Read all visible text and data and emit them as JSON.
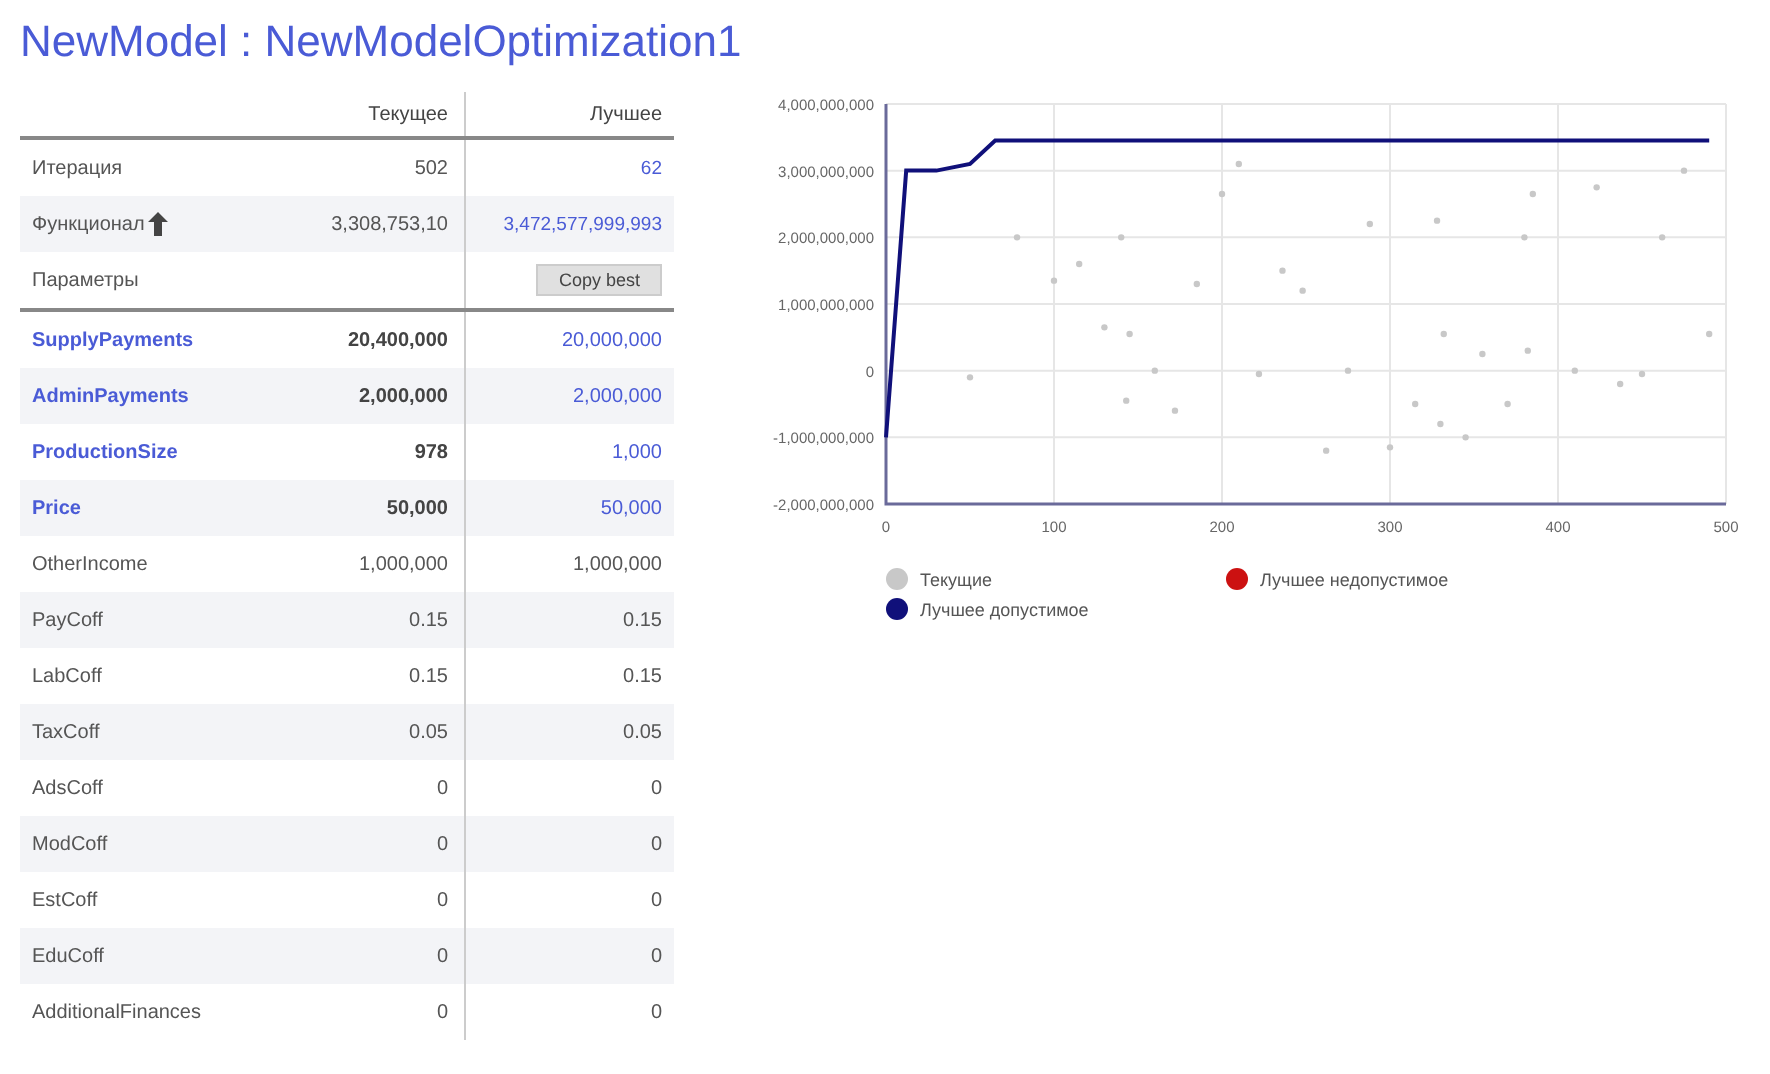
{
  "title": "NewModel : NewModelOptimization1",
  "columns": [
    "Текущее",
    "Лучшее"
  ],
  "summary": [
    {
      "label": "Итерация",
      "current": "502",
      "best": "62",
      "icon": false
    },
    {
      "label": "Функционал",
      "current": "3,308,753,10",
      "best": "3,472,577,999,993",
      "icon": true
    }
  ],
  "params_label": "Параметры",
  "copy_button": "Copy best",
  "params": [
    {
      "name": "SupplyPayments",
      "current": "20,400,000",
      "best": "20,000,000",
      "highlighted": true
    },
    {
      "name": "AdminPayments",
      "current": "2,000,000",
      "best": "2,000,000",
      "highlighted": true
    },
    {
      "name": "ProductionSize",
      "current": "978",
      "best": "1,000",
      "highlighted": true
    },
    {
      "name": "Price",
      "current": "50,000",
      "best": "50,000",
      "highlighted": true
    },
    {
      "name": "OtherIncome",
      "current": "1,000,000",
      "best": "1,000,000",
      "highlighted": false
    },
    {
      "name": "PayCoff",
      "current": "0.15",
      "best": "0.15",
      "highlighted": false
    },
    {
      "name": "LabCoff",
      "current": "0.15",
      "best": "0.15",
      "highlighted": false
    },
    {
      "name": "TaxCoff",
      "current": "0.05",
      "best": "0.05",
      "highlighted": false
    },
    {
      "name": "AdsCoff",
      "current": "0",
      "best": "0",
      "highlighted": false
    },
    {
      "name": "ModCoff",
      "current": "0",
      "best": "0",
      "highlighted": false
    },
    {
      "name": "EstCoff",
      "current": "0",
      "best": "0",
      "highlighted": false
    },
    {
      "name": "EduCoff",
      "current": "0",
      "best": "0",
      "highlighted": false
    },
    {
      "name": "AdditionalFinances",
      "current": "0",
      "best": "0",
      "highlighted": false
    }
  ],
  "chart": {
    "chart_data": {
      "type": "line",
      "x": [
        0,
        12,
        30,
        50,
        65,
        78,
        100,
        115,
        130,
        140,
        143,
        145,
        160,
        172,
        185,
        200,
        210,
        222,
        236,
        248,
        262,
        275,
        288,
        300,
        315,
        328,
        330,
        332,
        345,
        355,
        370,
        380,
        382,
        385,
        400,
        410,
        423,
        437,
        450,
        462,
        475,
        490
      ],
      "series": [
        {
          "name": "Текущие",
          "color": "#c8c8c8",
          "type": "scatter",
          "values": [
            null,
            null,
            null,
            -100000000,
            null,
            2000000000,
            1350000000,
            1600000000,
            650000000,
            2000000000,
            -450000000,
            550000000,
            0,
            -600000000,
            1300000000,
            2650000000,
            3100000000,
            -50000000,
            1500000000,
            1200000000,
            -1200000000,
            0,
            2200000000,
            -1150000000,
            -500000000,
            2250000000,
            -800000000,
            550000000,
            -1000000000,
            250000000,
            -500000000,
            2000000000,
            300000000,
            2650000000,
            null,
            0,
            2750000000,
            -200000000,
            -50000000,
            2000000000,
            3000000000,
            550000000
          ]
        },
        {
          "name": "Лучшее допустимое",
          "color": "#10107a",
          "type": "line",
          "values": [
            -1000000000,
            3000000000,
            3000000000,
            3100000000,
            3450000000,
            3450000000,
            3450000000,
            3450000000,
            3450000000,
            3450000000,
            3450000000,
            3450000000,
            3450000000,
            3450000000,
            3450000000,
            3450000000,
            3450000000,
            3450000000,
            3450000000,
            3450000000,
            3450000000,
            3450000000,
            3450000000,
            3450000000,
            3450000000,
            3450000000,
            3450000000,
            3450000000,
            3450000000,
            3450000000,
            3450000000,
            3450000000,
            3450000000,
            3450000000,
            3450000000,
            3450000000,
            3450000000,
            3450000000,
            3450000000,
            3450000000,
            3450000000,
            3450000000
          ]
        }
      ],
      "grid": true,
      "xlim": [
        0,
        500
      ],
      "ylim": [
        -2000000000,
        4000000000
      ],
      "xticks": [
        0,
        100,
        200,
        300,
        400,
        500
      ],
      "yticks": [
        {
          "value": -2000000000,
          "label": "-2,000,000,000"
        },
        {
          "value": -1000000000,
          "label": "-1,000,000,000"
        },
        {
          "value": 0,
          "label": "0"
        },
        {
          "value": 1000000000,
          "label": "1,000,000,000"
        },
        {
          "value": 2000000000,
          "label": "2,000,000,000"
        },
        {
          "value": 3000000000,
          "label": "3,000,000,000"
        },
        {
          "value": 4000000000,
          "label": "4,000,000,000"
        }
      ]
    },
    "legend_extra": [
      {
        "label": "Лучшее недопустимое",
        "color": "#cc1111"
      }
    ]
  }
}
